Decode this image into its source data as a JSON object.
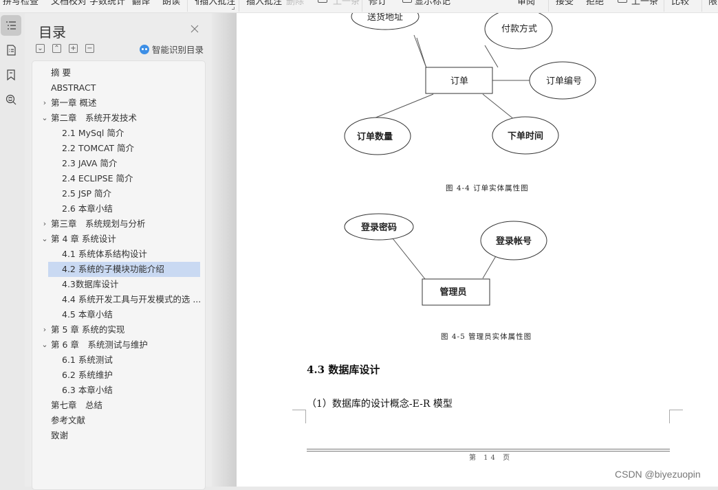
{
  "toolbar": {
    "items": [
      {
        "label": "拼写检查",
        "icon": "spellcheck-icon"
      },
      {
        "label": "文档校对",
        "icon": "proofread-icon"
      },
      {
        "label": "字数统计",
        "icon": "word-count-icon"
      },
      {
        "label": "翻译",
        "icon": "translate-icon"
      },
      {
        "label": "朗读",
        "icon": "read-aloud-icon"
      },
      {
        "label": "¶插入批注",
        "icon": "comment-icon"
      },
      {
        "label": "插入批注",
        "icon": "insert-comment-icon"
      },
      {
        "label": "删除",
        "icon": "delete-icon"
      },
      {
        "label": "上一条",
        "icon": "previous-icon"
      },
      {
        "label": "修订",
        "icon": "revise-icon"
      },
      {
        "label": "显示标记",
        "icon": "show-markup-icon"
      },
      {
        "label": "审阅",
        "icon": "review-icon"
      },
      {
        "label": "接受",
        "icon": "accept-icon"
      },
      {
        "label": "拒绝",
        "icon": "reject-icon"
      },
      {
        "label": "上一条",
        "icon": "prev-change-icon"
      },
      {
        "label": "比较",
        "icon": "compare-icon"
      },
      {
        "label": "限",
        "icon": "restrict-icon"
      }
    ]
  },
  "rail": {
    "items": [
      {
        "name": "toc",
        "icon": "toc-list-icon",
        "active": true
      },
      {
        "name": "outline",
        "icon": "document-outline-icon",
        "active": false
      },
      {
        "name": "bookmark",
        "icon": "bookmark-icon",
        "active": false
      },
      {
        "name": "find-replace",
        "icon": "search-replace-icon",
        "active": false
      }
    ]
  },
  "toc_panel": {
    "title": "目录",
    "close_icon": "close-icon",
    "controls": [
      {
        "name": "expand-all",
        "glyph": "⌄"
      },
      {
        "name": "collapse-all",
        "glyph": "⌃"
      },
      {
        "name": "add-level",
        "glyph": "+"
      },
      {
        "name": "remove-level",
        "glyph": "−"
      }
    ],
    "smart_toc_label": "智能识别目录",
    "items": [
      {
        "label": "摘 要",
        "level": 1,
        "arrow": ""
      },
      {
        "label": "ABSTRACT",
        "level": 1,
        "arrow": ""
      },
      {
        "label": "第一章 概述",
        "level": 1,
        "arrow": "›"
      },
      {
        "label": "第二章　系统开发技术",
        "level": 1,
        "arrow": "⌄"
      },
      {
        "label": "2.1 MySql 简介",
        "level": 2,
        "arrow": ""
      },
      {
        "label": "2.2 TOMCAT 简介",
        "level": 2,
        "arrow": ""
      },
      {
        "label": "2.3 JAVA  简介",
        "level": 2,
        "arrow": ""
      },
      {
        "label": "2.4 ECLIPSE 简介",
        "level": 2,
        "arrow": ""
      },
      {
        "label": "2.5 JSP 简介",
        "level": 2,
        "arrow": ""
      },
      {
        "label": "2.6  本章小结",
        "level": 2,
        "arrow": ""
      },
      {
        "label": "第三章　系统规划与分析",
        "level": 1,
        "arrow": "›"
      },
      {
        "label": "第 4 章  系统设计",
        "level": 1,
        "arrow": "⌄"
      },
      {
        "label": "4.1  系统体系结构设计",
        "level": 2,
        "arrow": ""
      },
      {
        "label": "4.2  系统的子模块功能介绍",
        "level": 2,
        "arrow": "",
        "selected": true
      },
      {
        "label": "4.3数据库设计",
        "level": 2,
        "arrow": ""
      },
      {
        "label": "4.4  系统开发工具与开发模式的选 ...",
        "level": 2,
        "arrow": ""
      },
      {
        "label": "4.5 本章小结",
        "level": 2,
        "arrow": ""
      },
      {
        "label": "第  5  章  系统的实现",
        "level": 1,
        "arrow": "›"
      },
      {
        "label": "第  6  章　系统测试与维护",
        "level": 1,
        "arrow": "⌄"
      },
      {
        "label": "6.1  系统测试",
        "level": 2,
        "arrow": ""
      },
      {
        "label": "6.2  系统维护",
        "level": 2,
        "arrow": ""
      },
      {
        "label": "6.3  本章小结",
        "level": 2,
        "arrow": ""
      },
      {
        "label": "第七章　总结",
        "level": 1,
        "arrow": ""
      },
      {
        "label": "参考文献",
        "level": 1,
        "arrow": ""
      },
      {
        "label": "致谢",
        "level": 1,
        "arrow": ""
      }
    ]
  },
  "document": {
    "figure1": {
      "entity": "订单",
      "attributes": [
        "送货地址",
        "付款方式",
        "订单编号",
        "订单数量",
        "下单时间"
      ],
      "caption": "图 4-4  订单实体属性图"
    },
    "figure2": {
      "entity": "管理员",
      "attributes": [
        "登录密码",
        "登录帐号"
      ],
      "caption": "图 4-5  管理员实体属性图"
    },
    "heading": "4.3 数据库设计",
    "paragraph": "（1）数据库的设计概念-E-R 模型",
    "page_number": "第 14 页"
  },
  "watermark": "CSDN @biyezuopin"
}
